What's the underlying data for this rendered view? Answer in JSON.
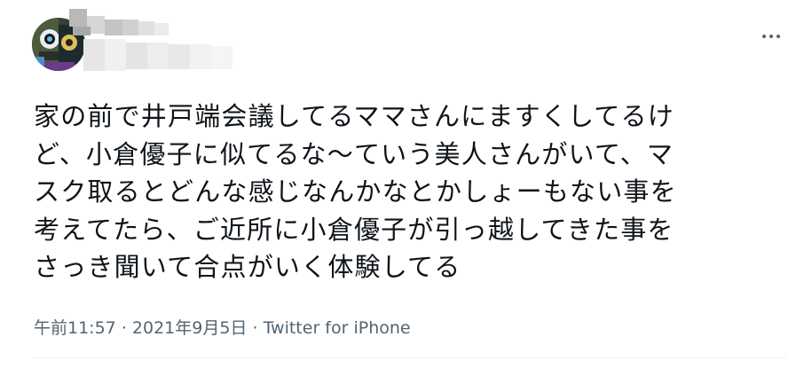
{
  "tweet": {
    "text_lines": [
      "家の前で井戸端会議してるママさんにますくしてるけ",
      "ど、小倉優子に似てるな〜ていう美人さんがいて、マ",
      "スク取るとどんな感じなんかなとかしょーもない事を",
      "考えてたら、ご近所に小倉優子が引っ越してきた事を",
      "さっき聞いて合点がいく体験してる"
    ],
    "time": "午前11:57",
    "separator": "·",
    "date": "2021年9月5日",
    "source": "Twitter for iPhone"
  },
  "icons": {
    "more": "more-horizontal-icon",
    "avatar": "avatar-image"
  },
  "colors": {
    "text": "#0f1419",
    "meta": "#536471",
    "divider": "#eff3f4"
  }
}
